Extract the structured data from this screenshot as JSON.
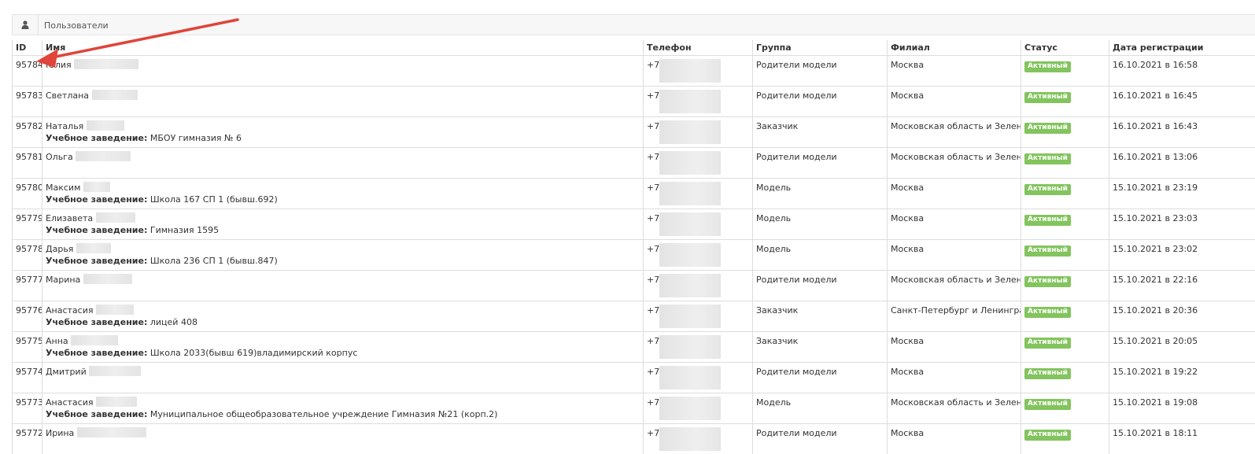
{
  "panel": {
    "title": "Пользователи",
    "icon": "user-icon"
  },
  "columns": {
    "id": "ID",
    "name": "Имя",
    "phone": "Телефон",
    "group": "Группа",
    "branch": "Филиал",
    "status": "Статус",
    "date": "Дата регистрации"
  },
  "edu_label": "Учебное заведение:",
  "status_color": "#82c45d",
  "arrow_color": "#e0443a",
  "rows": [
    {
      "id": "95784",
      "name": "Юлия",
      "phone": "+7",
      "group": "Родители модели",
      "branch": "Москва",
      "status": "Активный",
      "date": "16.10.2021 в 16:58",
      "school": ""
    },
    {
      "id": "95783",
      "name": "Светлана",
      "phone": "+7",
      "group": "Родители модели",
      "branch": "Москва",
      "status": "Активный",
      "date": "16.10.2021 в 16:45",
      "school": ""
    },
    {
      "id": "95782",
      "name": "Наталья",
      "phone": "+7",
      "group": "Заказчик",
      "branch": "Московская область и Зеленоград",
      "status": "Активный",
      "date": "16.10.2021 в 16:43",
      "school": "МБОУ гимназия № 6"
    },
    {
      "id": "95781",
      "name": "Ольга",
      "phone": "+7",
      "group": "Родители модели",
      "branch": "Московская область и Зеленоград",
      "status": "Активный",
      "date": "16.10.2021 в 13:06",
      "school": ""
    },
    {
      "id": "95780",
      "name": "Максим",
      "phone": "+7",
      "group": "Модель",
      "branch": "Москва",
      "status": "Активный",
      "date": "15.10.2021 в 23:19",
      "school": "Школа 167 СП 1 (бывш.692)"
    },
    {
      "id": "95779",
      "name": "Елизавета",
      "phone": "+7",
      "group": "Модель",
      "branch": "Москва",
      "status": "Активный",
      "date": "15.10.2021 в 23:03",
      "school": "Гимназия 1595"
    },
    {
      "id": "95778",
      "name": "Дарья",
      "phone": "+7",
      "group": "Модель",
      "branch": "Москва",
      "status": "Активный",
      "date": "15.10.2021 в 23:02",
      "school": "Школа 236 СП 1 (бывш.847)"
    },
    {
      "id": "95777",
      "name": "Марина",
      "phone": "+7",
      "group": "Родители модели",
      "branch": "Московская область и Зеленоград",
      "status": "Активный",
      "date": "15.10.2021 в 22:16",
      "school": ""
    },
    {
      "id": "95776",
      "name": "Анастасия",
      "phone": "+7",
      "group": "Заказчик",
      "branch": "Санкт-Петербург и Ленинградская область",
      "status": "Активный",
      "date": "15.10.2021 в 20:36",
      "school": "лицей 408"
    },
    {
      "id": "95775",
      "name": "Анна",
      "phone": "+7",
      "group": "Заказчик",
      "branch": "Москва",
      "status": "Активный",
      "date": "15.10.2021 в 20:05",
      "school": "Школа 2033(бывш 619)владимирский корпус"
    },
    {
      "id": "95774",
      "name": "Дмитрий",
      "phone": "+7",
      "group": "Родители модели",
      "branch": "Москва",
      "status": "Активный",
      "date": "15.10.2021 в 19:22",
      "school": ""
    },
    {
      "id": "95773",
      "name": "Анастасия",
      "phone": "+7",
      "group": "Модель",
      "branch": "Московская область и Зеленоград",
      "status": "Активный",
      "date": "15.10.2021 в 19:08",
      "school": "Муниципальное общеобразовательное учреждение Гимназия №21 (корп.2)"
    },
    {
      "id": "95772",
      "name": "Ирина",
      "phone": "+7",
      "group": "Родители модели",
      "branch": "Москва",
      "status": "Активный",
      "date": "15.10.2021 в 18:11",
      "school": ""
    }
  ]
}
